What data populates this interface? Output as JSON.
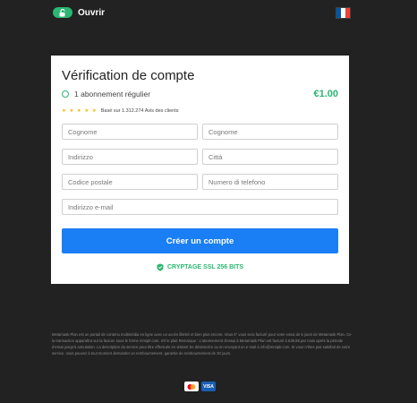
{
  "header": {
    "unlock_label": "Ouvrir",
    "language_flag_icon": "france-flag-icon",
    "flag_colors": [
      "#0055a4",
      "#ffffff",
      "#ef4135"
    ]
  },
  "form": {
    "title": "Vérification de compte",
    "subscription_label": "1 abonnement régulier",
    "price": "€1.00",
    "rating_stars": "★ ★ ★ ★ ★",
    "rating_text": "Basé sur 1.312.274 Avis des clients",
    "fields": {
      "first_name_placeholder": "Cognome",
      "last_name_placeholder": "Cognome",
      "address_placeholder": "Indirizzo",
      "city_placeholder": "Città",
      "zip_placeholder": "Codice postale",
      "phone_placeholder": "Numero di telefono",
      "email_placeholder": "Indirizzo e-mail"
    },
    "submit_label": "Créer un compte",
    "ssl_label": "CRYPTAGE SSL 256 BITS"
  },
  "footer": {
    "disclaimer": "Metamask Plan est un portail de contenu multimédia en ligne avec un accès illimité et bien plus encore. Vous 6° vous sera facturé pour votre essai de 5 jours de Metamask Plan. Ce la transaction apparaîtra sur la facture sous le forme mmiplr.com. S'il le plait Remarque : L'abonnement d'essai à Metamask Plan est facturé à €39.88 par mois après la période d'essai jusqu'à annulation. La description du service peut être effectuée en visitant Se désinscrire ou en envoyant un e-mail à info@mmiplr.com. Si vous n'êtes pas satisfait de votre service, vous pouvez à tout moment demander un remboursement, garantie de remboursement de 30 jours.",
    "card_visa_label": "VISA"
  },
  "colors": {
    "accent_green": "#2bb673",
    "cta_blue": "#1a7ef5",
    "background": "#222222"
  }
}
